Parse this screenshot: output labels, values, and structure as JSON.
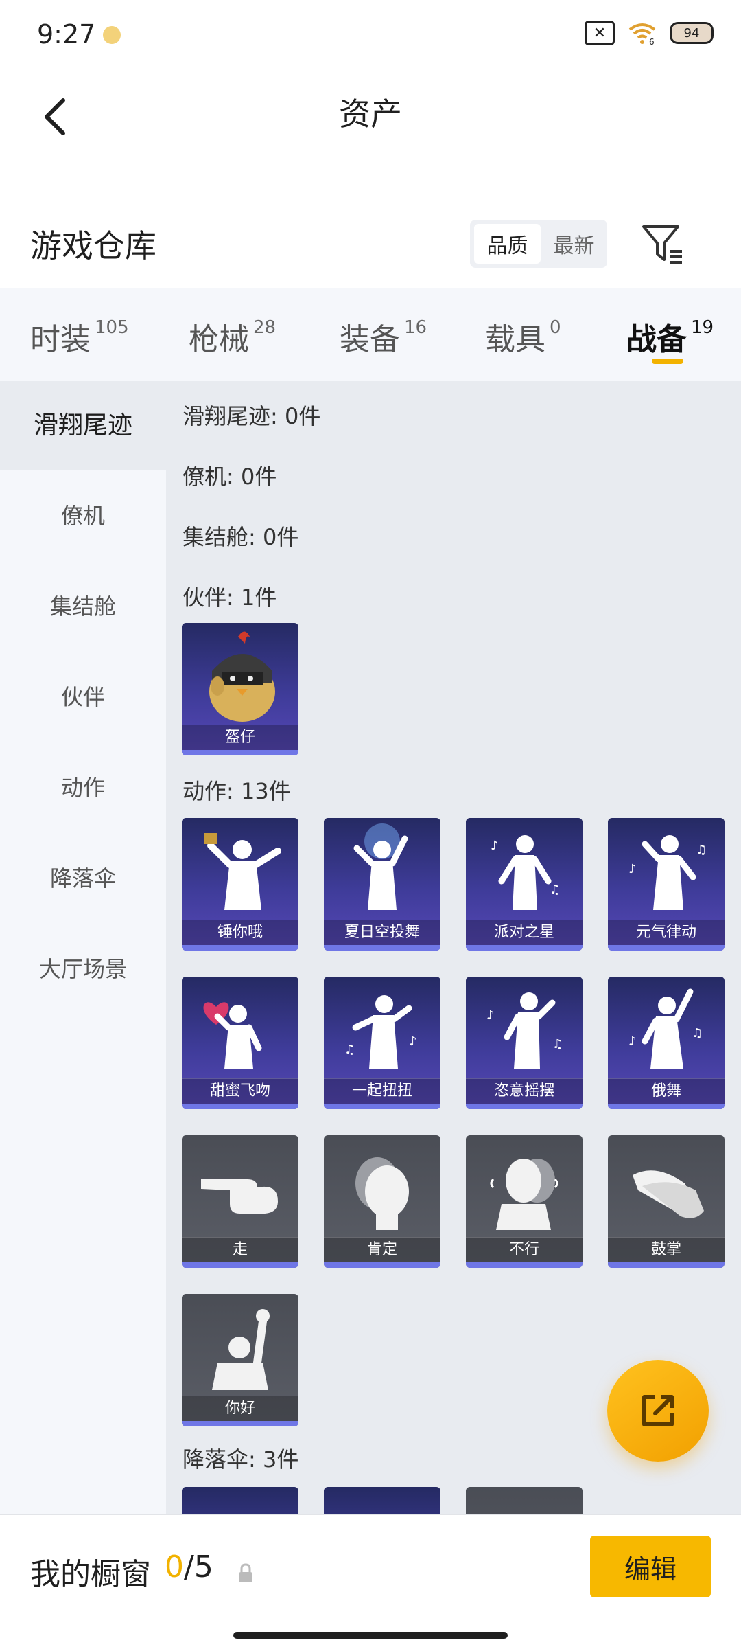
{
  "status_bar": {
    "time": "9:27",
    "battery": "94",
    "network": "6"
  },
  "header": {
    "title": "资产"
  },
  "warehouse": {
    "title": "游戏仓库",
    "sort_options": [
      "品质",
      "最新"
    ],
    "selected_sort": "品质"
  },
  "category_tabs": [
    {
      "label": "时装",
      "count": "105"
    },
    {
      "label": "枪械",
      "count": "28"
    },
    {
      "label": "装备",
      "count": "16"
    },
    {
      "label": "载具",
      "count": "0"
    },
    {
      "label": "战备",
      "count": "19",
      "active": true
    }
  ],
  "sidebar": {
    "items": [
      "滑翔尾迹",
      "僚机",
      "集结舱",
      "伙伴",
      "动作",
      "降落伞",
      "大厅场景"
    ],
    "active": "滑翔尾迹"
  },
  "sections": {
    "glide": "滑翔尾迹: 0件",
    "wingman": "僚机: 0件",
    "capsule": "集结舱: 0件",
    "partner": "伙伴: 1件",
    "emote": "动作: 13件",
    "parachute": "降落伞: 3件"
  },
  "partner_items": [
    {
      "name": "盔仔",
      "icon": "chick-helmet-icon"
    }
  ],
  "emote_items": [
    {
      "name": "锤你哦",
      "icon": "hammer-dance-icon",
      "style": "purple"
    },
    {
      "name": "夏日空投舞",
      "icon": "sparkle-dance-icon",
      "style": "purple"
    },
    {
      "name": "派对之星",
      "icon": "party-dance-icon",
      "style": "purple"
    },
    {
      "name": "元气律动",
      "icon": "groove-dance-icon",
      "style": "purple"
    },
    {
      "name": "甜蜜飞吻",
      "icon": "heart-kiss-icon",
      "style": "purple"
    },
    {
      "name": "一起扭扭",
      "icon": "twist-dance-icon",
      "style": "purple"
    },
    {
      "name": "恣意摇摆",
      "icon": "sway-dance-icon",
      "style": "purple"
    },
    {
      "name": "俄舞",
      "icon": "russian-dance-icon",
      "style": "purple"
    },
    {
      "name": "走",
      "icon": "point-hand-icon",
      "style": "gray"
    },
    {
      "name": "肯定",
      "icon": "nod-head-icon",
      "style": "gray"
    },
    {
      "name": "不行",
      "icon": "shake-head-icon",
      "style": "gray"
    },
    {
      "name": "鼓掌",
      "icon": "clap-hands-icon",
      "style": "gray"
    },
    {
      "name": "你好",
      "icon": "wave-hello-icon",
      "style": "gray"
    }
  ],
  "bottom_bar": {
    "label": "我的橱窗",
    "current": "0",
    "total": "/5",
    "edit": "编辑"
  },
  "colors": {
    "accent": "#f2b200",
    "card_purple": "#3f3c9a",
    "card_gray": "#55585f",
    "card_bar": "#6f76e6"
  }
}
